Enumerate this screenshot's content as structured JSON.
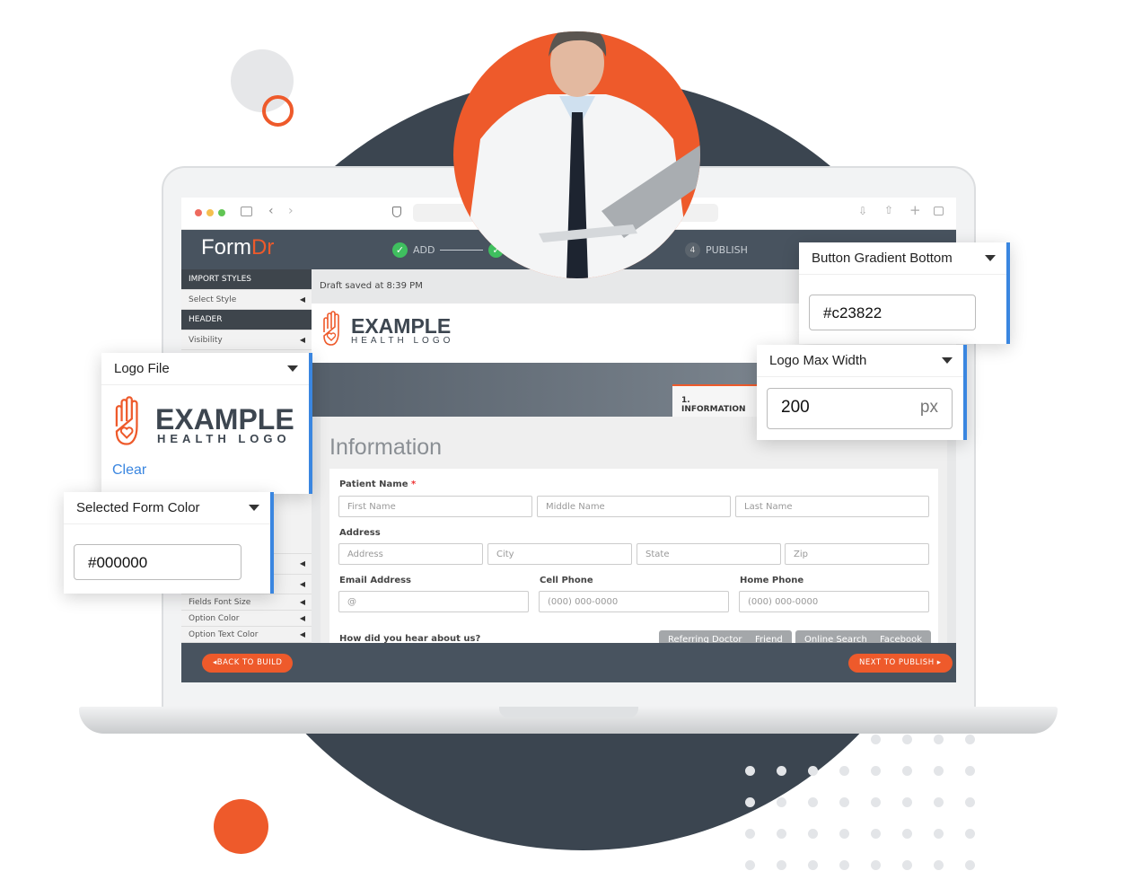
{
  "colors": {
    "accent": "#ee5a2b",
    "dark": "#3b4550",
    "selected_blue": "#3a86e0",
    "check_green": "#3fbf5f"
  },
  "app": {
    "logo_part1": "Form",
    "logo_part2": "Dr"
  },
  "steps": [
    {
      "label": "ADD",
      "status": "done"
    },
    {
      "label": "",
      "status": "done"
    },
    {
      "number": "4",
      "label": "PUBLISH",
      "status": "pending"
    }
  ],
  "sidebar": {
    "items": [
      {
        "label": "IMPORT STYLES",
        "type": "header"
      },
      {
        "label": "Select Style",
        "type": "item"
      },
      {
        "label": "HEADER",
        "type": "header"
      },
      {
        "label": "Visibility",
        "type": "item"
      },
      {
        "label": "Fields Font Size",
        "type": "item"
      },
      {
        "label": "Option Color",
        "type": "item"
      },
      {
        "label": "Option Text Color",
        "type": "item"
      }
    ]
  },
  "main": {
    "draft_status": "Draft saved at 8:39 PM",
    "logo": {
      "line1": "EXAMPLE",
      "line2": "HEALTH LOGO"
    },
    "tab": "1. INFORMATION",
    "form_title": "Information",
    "fields": {
      "patient_name_label": "Patient Name",
      "required_mark": "*",
      "first_name": "First Name",
      "middle_name": "Middle Name",
      "last_name": "Last Name",
      "address_label": "Address",
      "address": "Address",
      "city": "City",
      "state": "State",
      "zip": "Zip",
      "email_label": "Email Address",
      "email_placeholder": "@",
      "cell_label": "Cell Phone",
      "cell_placeholder": "(000) 000-0000",
      "home_label": "Home Phone",
      "home_placeholder": "(000) 000-0000",
      "hear_label": "How did you hear about us?",
      "hear_options": [
        "Referring Doctor",
        "Friend",
        "Online Search",
        "Facebook"
      ]
    }
  },
  "footer": {
    "back": "BACK TO BUILD",
    "next": "NEXT TO PUBLISH"
  },
  "popovers": {
    "button_gradient": {
      "title": "Button Gradient Bottom",
      "value": "#c23822"
    },
    "logo_max_width": {
      "title": "Logo Max Width",
      "value": "200",
      "unit": "px"
    },
    "logo_file": {
      "title": "Logo File",
      "clear": "Clear"
    },
    "form_color": {
      "title": "Selected Form Color",
      "value": "#000000"
    }
  }
}
